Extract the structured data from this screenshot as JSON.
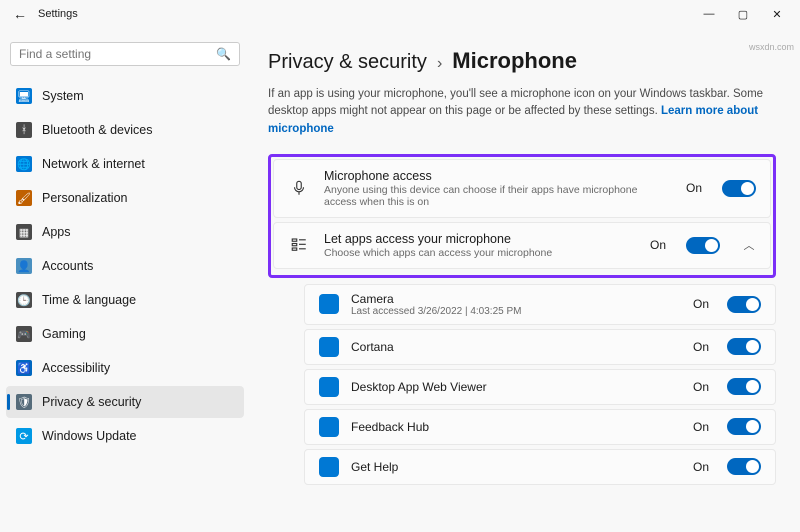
{
  "titlebar": {
    "app": "Settings"
  },
  "search": {
    "placeholder": "Find a setting"
  },
  "nav": [
    {
      "label": "System",
      "iconColor": "#0078d4"
    },
    {
      "label": "Bluetooth & devices",
      "iconColor": "#4a4a4a"
    },
    {
      "label": "Network & internet",
      "iconColor": "#0078d4"
    },
    {
      "label": "Personalization",
      "iconColor": "#c06000"
    },
    {
      "label": "Apps",
      "iconColor": "#4a4a4a"
    },
    {
      "label": "Accounts",
      "iconColor": "#4a90c0"
    },
    {
      "label": "Time & language",
      "iconColor": "#4a4a4a"
    },
    {
      "label": "Gaming",
      "iconColor": "#4a4a4a"
    },
    {
      "label": "Accessibility",
      "iconColor": "#0067c0"
    },
    {
      "label": "Privacy & security",
      "iconColor": "#556b7a",
      "active": true
    },
    {
      "label": "Windows Update",
      "iconColor": "#0099e5"
    }
  ],
  "breadcrumb": {
    "parent": "Privacy & security",
    "sep": "›",
    "current": "Microphone"
  },
  "description": {
    "text": "If an app is using your microphone, you'll see a microphone icon on your Windows taskbar. Some desktop apps might not appear on this page or be affected by these settings.",
    "link": "Learn more about microphone"
  },
  "settings": [
    {
      "title": "Microphone access",
      "subtitle": "Anyone using this device can choose if their apps have microphone access when this is on",
      "state": "On",
      "icon": "mic"
    },
    {
      "title": "Let apps access your microphone",
      "subtitle": "Choose which apps can access your microphone",
      "state": "On",
      "icon": "apps",
      "expandable": true
    }
  ],
  "apps": [
    {
      "name": "Camera",
      "subtitle": "Last accessed 3/26/2022 | 4:03:25 PM",
      "state": "On"
    },
    {
      "name": "Cortana",
      "state": "On"
    },
    {
      "name": "Desktop App Web Viewer",
      "state": "On"
    },
    {
      "name": "Feedback Hub",
      "state": "On"
    },
    {
      "name": "Get Help",
      "state": "On"
    }
  ],
  "watermark": "wsxdn.com"
}
